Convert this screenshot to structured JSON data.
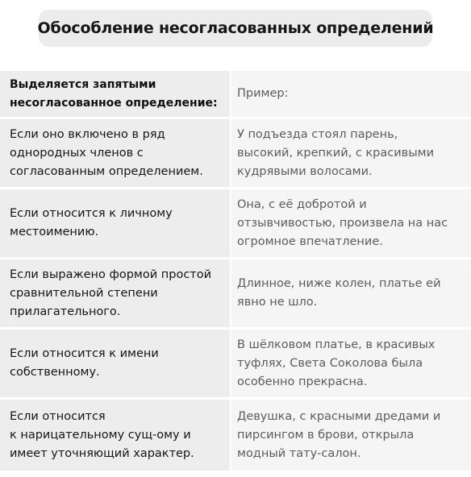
{
  "title": "Обособление несогласованных определений",
  "table": {
    "header": {
      "condition": "Выделяется запятыми\nнесогласованное определение:",
      "example": "Пример:"
    },
    "rows": [
      {
        "condition": "Если оно включено в ряд\nоднородных членов с\nсогласованным определением.",
        "example": "У подъезда стоял парень,\nвысокий, крепкий, с красивыми\nкудрявыми волосами."
      },
      {
        "condition": "Если относится к личному\nместоимению.",
        "example": "Она, с её добротой и\nотзывчивостью, произвела на нас\nогромное впечатление."
      },
      {
        "condition": "Если выражено формой простой\nсравнительной степени\nприлагательного.",
        "example": "Длинное, ниже колен, платье ей\nявно не шло."
      },
      {
        "condition": "Если относится к имени\nсобственному.",
        "example": "В шёлковом платье, в красивых\nтуфлях, Света Соколова была\nособенно прекрасна."
      },
      {
        "condition": "Если относится\nк нарицательному сущ-ому и\nимеет уточняющий характер.",
        "example": "Девушка, с красными дредами и\nпирсингом в брови, открыла\nмодный тату-салон."
      }
    ]
  }
}
